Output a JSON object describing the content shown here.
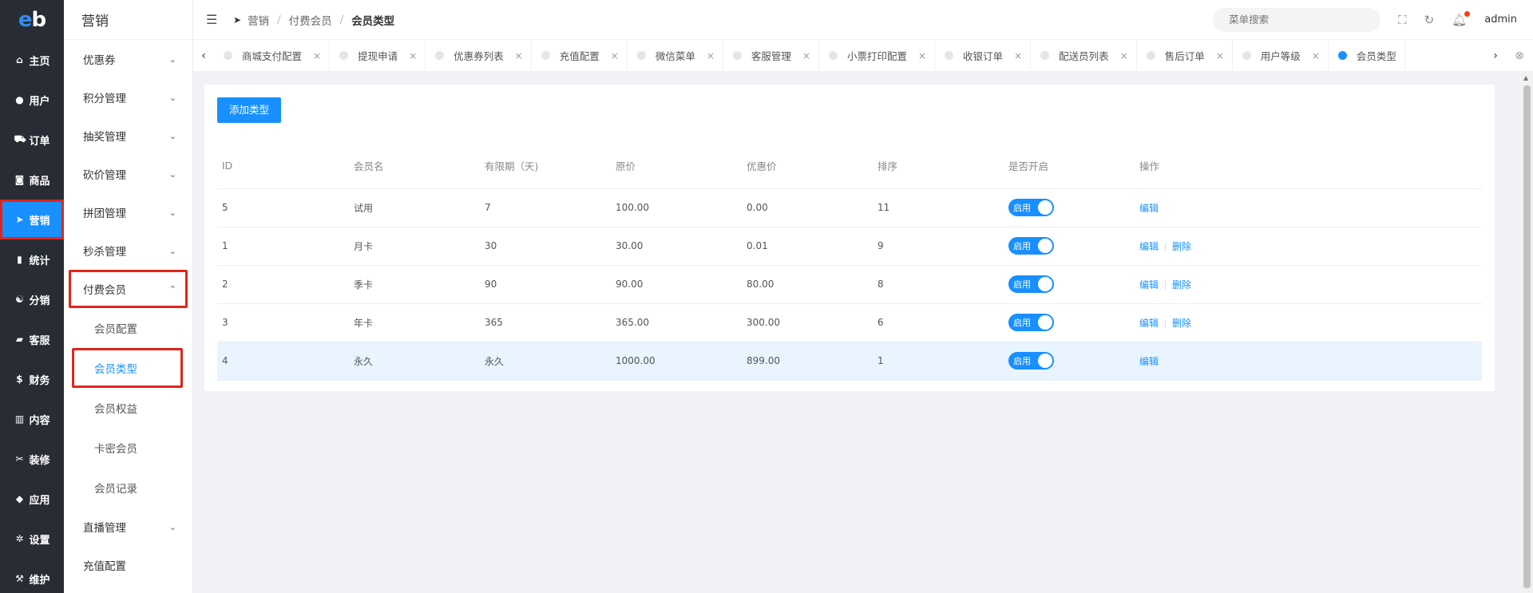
{
  "logo": {
    "e": "e",
    "b": "b"
  },
  "rail": [
    {
      "icon": "home-icon",
      "glyph": "⌂",
      "label": "主页"
    },
    {
      "icon": "user-icon",
      "glyph": "●",
      "label": "用户"
    },
    {
      "icon": "cart-icon",
      "glyph": "⛟",
      "label": "订单"
    },
    {
      "icon": "shop-icon",
      "glyph": "◙",
      "label": "商品"
    },
    {
      "icon": "send-icon",
      "glyph": "➤",
      "label": "营销",
      "active": true
    },
    {
      "icon": "chart-icon",
      "glyph": "▮",
      "label": "统计"
    },
    {
      "icon": "share-icon",
      "glyph": "☯",
      "label": "分销"
    },
    {
      "icon": "chat-icon",
      "glyph": "▰",
      "label": "客服"
    },
    {
      "icon": "dollar-icon",
      "glyph": "$",
      "label": "财务"
    },
    {
      "icon": "book-icon",
      "glyph": "▥",
      "label": "内容"
    },
    {
      "icon": "tools-icon",
      "glyph": "✂",
      "label": "装修"
    },
    {
      "icon": "cube-icon",
      "glyph": "◆",
      "label": "应用"
    },
    {
      "icon": "gear-icon",
      "glyph": "✲",
      "label": "设置"
    },
    {
      "icon": "hammer-icon",
      "glyph": "⚒",
      "label": "维护"
    }
  ],
  "submenu": {
    "title": "营销",
    "groups_top": [
      "优惠券",
      "积分管理",
      "抽奖管理",
      "砍价管理",
      "拼团管理",
      "秒杀管理"
    ],
    "open_group": "付费会员",
    "sub_items": [
      "会员配置",
      "会员类型",
      "会员权益",
      "卡密会员",
      "会员记录"
    ],
    "active_sub": "会员类型",
    "groups_bottom": [
      "直播管理"
    ],
    "plain_bottom": "充值配置"
  },
  "header": {
    "crumbs": [
      "营销",
      "付费会员",
      "会员类型"
    ],
    "search_placeholder": "菜单搜索",
    "user": "admin"
  },
  "tabs": [
    "商城支付配置",
    "提现申请",
    "优惠券列表",
    "充值配置",
    "微信菜单",
    "客服管理",
    "小票打印配置",
    "收银订单",
    "配送员列表",
    "售后订单",
    "用户等级",
    "会员类型"
  ],
  "active_tab": "会员类型",
  "content": {
    "add_button": "添加类型",
    "columns": [
      "ID",
      "会员名",
      "有限期（天)",
      "原价",
      "优惠价",
      "排序",
      "是否开启",
      "操作"
    ],
    "rows": [
      {
        "id": "5",
        "name": "试用",
        "period": "7",
        "price": "100.00",
        "discount": "0.00",
        "sort": "11",
        "status": "启用",
        "actions": [
          "编辑"
        ]
      },
      {
        "id": "1",
        "name": "月卡",
        "period": "30",
        "price": "30.00",
        "discount": "0.01",
        "sort": "9",
        "status": "启用",
        "actions": [
          "编辑",
          "删除"
        ]
      },
      {
        "id": "2",
        "name": "季卡",
        "period": "90",
        "price": "90.00",
        "discount": "80.00",
        "sort": "8",
        "status": "启用",
        "actions": [
          "编辑",
          "删除"
        ]
      },
      {
        "id": "3",
        "name": "年卡",
        "period": "365",
        "price": "365.00",
        "discount": "300.00",
        "sort": "6",
        "status": "启用",
        "actions": [
          "编辑",
          "删除"
        ]
      },
      {
        "id": "4",
        "name": "永久",
        "period": "永久",
        "price": "1000.00",
        "discount": "899.00",
        "sort": "1",
        "status": "启用",
        "actions": [
          "编辑"
        ],
        "highlight": true
      }
    ]
  }
}
